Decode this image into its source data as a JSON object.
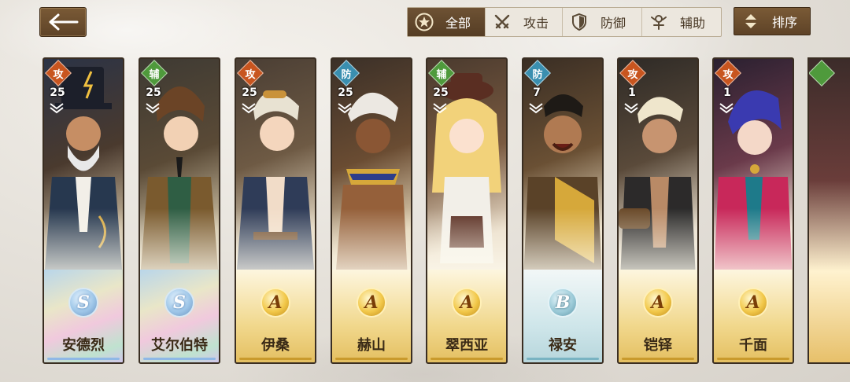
{
  "filters": {
    "all_label": "全部",
    "attack_label": "攻击",
    "defense_label": "防御",
    "support_label": "辅助",
    "active": "all"
  },
  "sort_label": "排序",
  "icons": {
    "back": "back-arrow-icon",
    "all": "star-circle-icon",
    "attack": "crossed-swords-icon",
    "defense": "shield-icon",
    "support": "support-emblem-icon",
    "sort": "sort-arrows-icon",
    "star_mark": "star-badge-icon"
  },
  "colors": {
    "attack": "#c8551f",
    "support": "#4f9a3c",
    "defense": "#3a8fb0",
    "brown": "#6e5234"
  },
  "heroes": [
    {
      "role": "攻",
      "level": "25",
      "rank": "S",
      "name": "安德烈"
    },
    {
      "role": "辅",
      "level": "25",
      "rank": "S",
      "name": "艾尔伯特"
    },
    {
      "role": "攻",
      "level": "25",
      "rank": "A",
      "name": "伊桑"
    },
    {
      "role": "防",
      "level": "25",
      "rank": "A",
      "name": "赫山"
    },
    {
      "role": "辅",
      "level": "25",
      "rank": "A",
      "name": "翠西亚"
    },
    {
      "role": "防",
      "level": "7",
      "rank": "B",
      "name": "禄安"
    },
    {
      "role": "攻",
      "level": "1",
      "rank": "A",
      "name": "铠铎"
    },
    {
      "role": "攻",
      "level": "1",
      "rank": "A",
      "name": "千面"
    }
  ]
}
